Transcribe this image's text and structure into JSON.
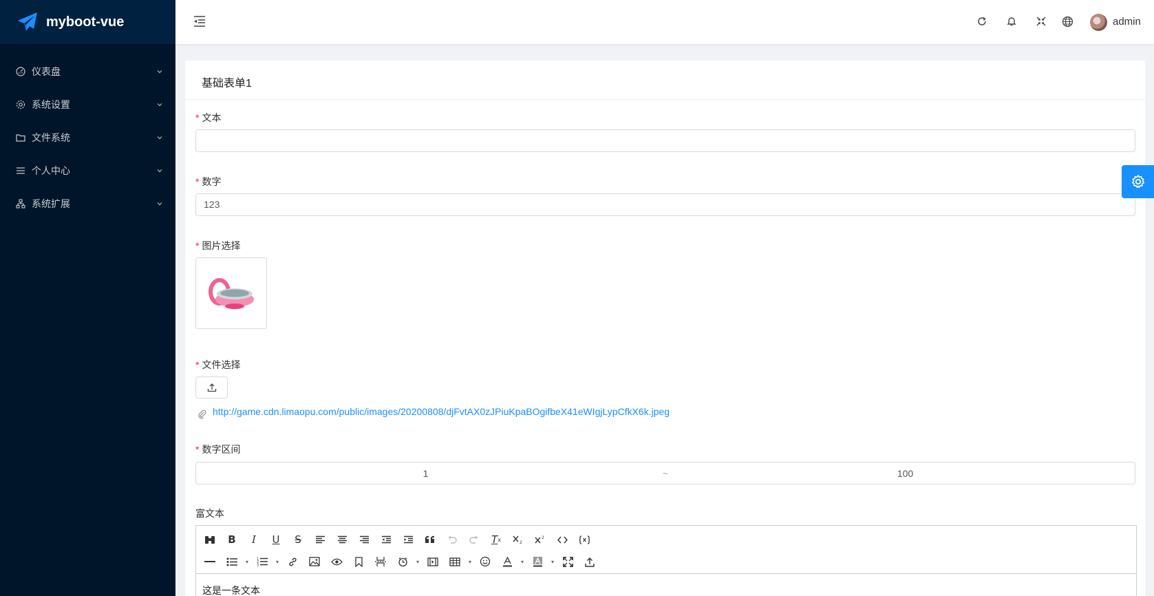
{
  "app": {
    "title": "myboot-vue"
  },
  "sidebar": {
    "items": [
      {
        "label": "仪表盘",
        "icon": "dashboard-icon"
      },
      {
        "label": "系统设置",
        "icon": "gear-icon"
      },
      {
        "label": "文件系统",
        "icon": "folder-icon"
      },
      {
        "label": "个人中心",
        "icon": "list-icon"
      },
      {
        "label": "系统扩展",
        "icon": "cluster-icon"
      }
    ]
  },
  "header": {
    "user": "admin",
    "icons": [
      "refresh-icon",
      "bell-icon",
      "fullscreen-icon",
      "globe-icon"
    ]
  },
  "card": {
    "title": "基础表单1"
  },
  "form": {
    "text": {
      "label": "文本",
      "value": ""
    },
    "number": {
      "label": "数字",
      "value": "123"
    },
    "image": {
      "label": "图片选择"
    },
    "file": {
      "label": "文件选择",
      "url": "http://game.cdn.limaopu.com/public/images/20200808/djFvtAX0zJPiuKpaBOgifbeX41eWIgjLypCfkX6k.jpeg"
    },
    "range": {
      "label": "数字区间",
      "min": "1",
      "sep": "~",
      "max": "100"
    },
    "rich": {
      "label": "富文本",
      "content": "这是一条文本"
    }
  },
  "editor": {
    "row1": [
      "B",
      "I",
      "U",
      "S"
    ],
    "clear": "T"
  }
}
